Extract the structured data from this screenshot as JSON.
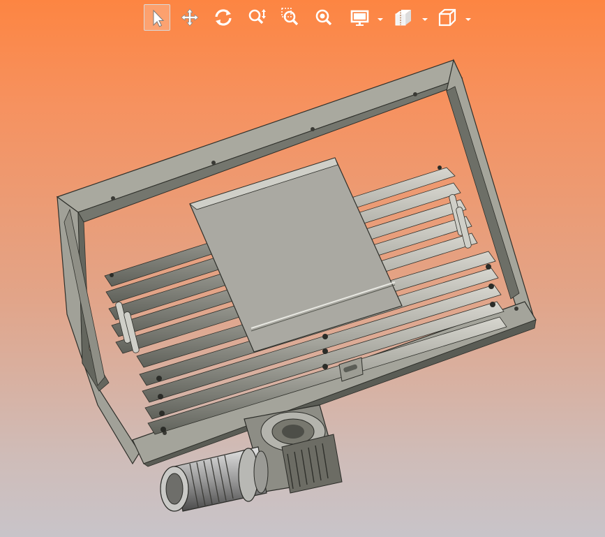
{
  "viewer": {
    "toolbar": {
      "tools": [
        {
          "name": "select",
          "icon": "pointer-arrow-icon",
          "active": true
        },
        {
          "name": "pan",
          "icon": "pan-arrows-icon",
          "active": false
        },
        {
          "name": "rotate",
          "icon": "rotate-icon",
          "active": false
        },
        {
          "name": "zoom",
          "icon": "zoom-updown-icon",
          "active": false
        },
        {
          "name": "zoom-window",
          "icon": "zoom-window-icon",
          "active": false
        },
        {
          "name": "zoom-fit",
          "icon": "zoom-fit-icon",
          "active": false
        },
        {
          "name": "display",
          "icon": "monitor-icon",
          "active": false,
          "dropdown": true
        },
        {
          "name": "section",
          "icon": "section-view-icon",
          "active": false,
          "dropdown": true
        },
        {
          "name": "view-orientation",
          "icon": "cube-view-icon",
          "active": false,
          "dropdown": true
        }
      ]
    },
    "model": {
      "description_icon": "roller-conveyor-assembly-3d-icon"
    },
    "colors": {
      "background_top": "#fd8542",
      "background_bottom": "#c8c4c9",
      "toolbar_icon": "#ffffff",
      "frame_face": "#a9a9a0",
      "frame_dark": "#55574f",
      "plate_face": "#aaa9a2"
    }
  }
}
